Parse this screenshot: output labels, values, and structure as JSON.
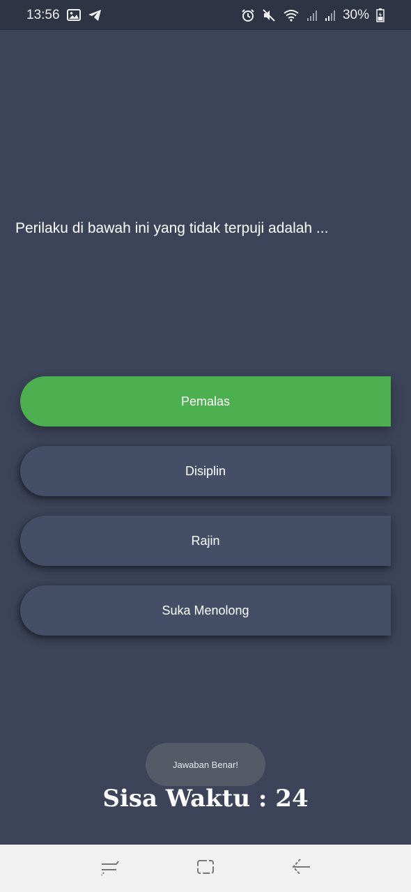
{
  "status_bar": {
    "time": "13:56",
    "battery": "30%",
    "left_icons": [
      "image-icon",
      "telegram-icon"
    ],
    "right_icons": [
      "alarm-icon",
      "mute-icon",
      "wifi-icon",
      "signal-icon",
      "signal-icon",
      "battery-icon"
    ]
  },
  "question": {
    "text": "Perilaku di bawah ini yang tidak terpuji adalah ..."
  },
  "answers": [
    {
      "label": "Pemalas",
      "state": "correct"
    },
    {
      "label": "Disiplin",
      "state": "default"
    },
    {
      "label": "Rajin",
      "state": "default"
    },
    {
      "label": "Suka Menolong",
      "state": "default"
    }
  ],
  "toast": {
    "text": "Jawaban Benar!"
  },
  "timer": {
    "text": "Sisa Waktu : 24"
  },
  "navbar": {
    "buttons": [
      "recent-apps-icon",
      "home-icon",
      "back-icon"
    ]
  },
  "colors": {
    "background": "#3d4459",
    "status_bar": "#2f3444",
    "answer_default": "#444e67",
    "answer_correct": "#4caf50",
    "navbar": "#f1f1f1"
  }
}
